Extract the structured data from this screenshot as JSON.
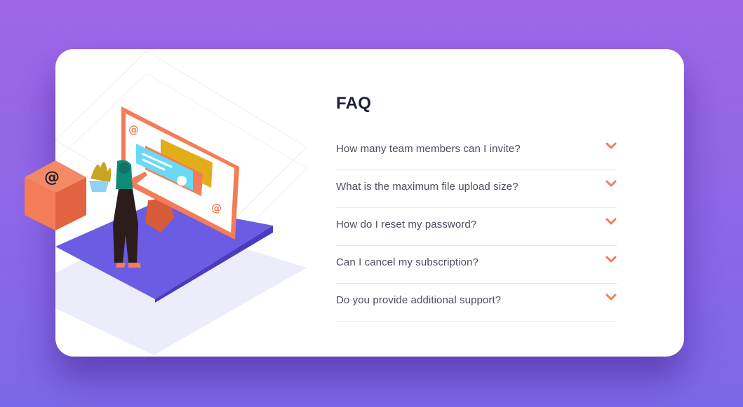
{
  "faq": {
    "title": "FAQ",
    "items": [
      {
        "question": "How many team members can I invite?",
        "expanded": false
      },
      {
        "question": "What is the maximum file upload size?",
        "expanded": false
      },
      {
        "question": "How do I reset my password?",
        "expanded": false
      },
      {
        "question": "Can I cancel my subscription?",
        "expanded": false
      },
      {
        "question": "Do you provide additional support?",
        "expanded": false
      }
    ]
  },
  "illustration": {
    "screen_symbol": "@",
    "box_symbol": "@"
  },
  "colors": {
    "background_top": "#a066e8",
    "background_bottom": "#7b68e6",
    "card": "#ffffff",
    "accent": "#f47c57",
    "title": "#1e1f36",
    "question": "#4b4c5f",
    "divider": "#e8e8ea"
  }
}
